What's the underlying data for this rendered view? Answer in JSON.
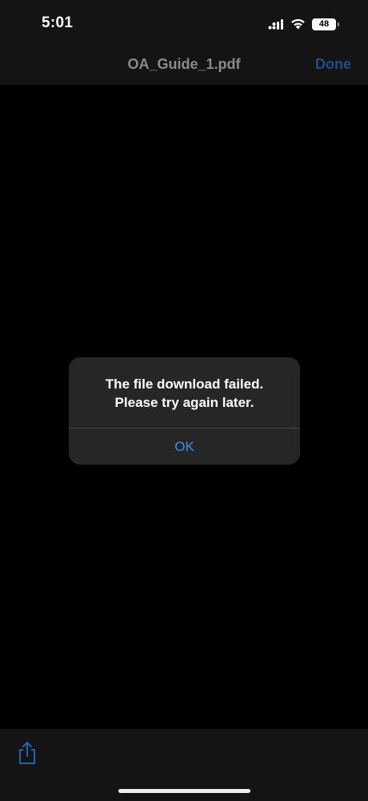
{
  "status_bar": {
    "time": "5:01",
    "battery_level": "48",
    "icons": [
      "signal-icon",
      "wifi-icon",
      "battery-icon"
    ]
  },
  "nav_bar": {
    "title": "OA_Guide_1.pdf",
    "done_label": "Done"
  },
  "alert": {
    "message_line1": "The file download failed.",
    "message_line2": "Please try again later.",
    "ok_label": "OK"
  },
  "toolbar": {
    "share_icon": "share-icon"
  },
  "colors": {
    "background": "#000000",
    "bar_background": "#141414",
    "alert_background": "#262626",
    "accent_blue": "#3a8ef5",
    "done_blue": "#1e4f8c",
    "title_gray": "#8a8a8a"
  }
}
